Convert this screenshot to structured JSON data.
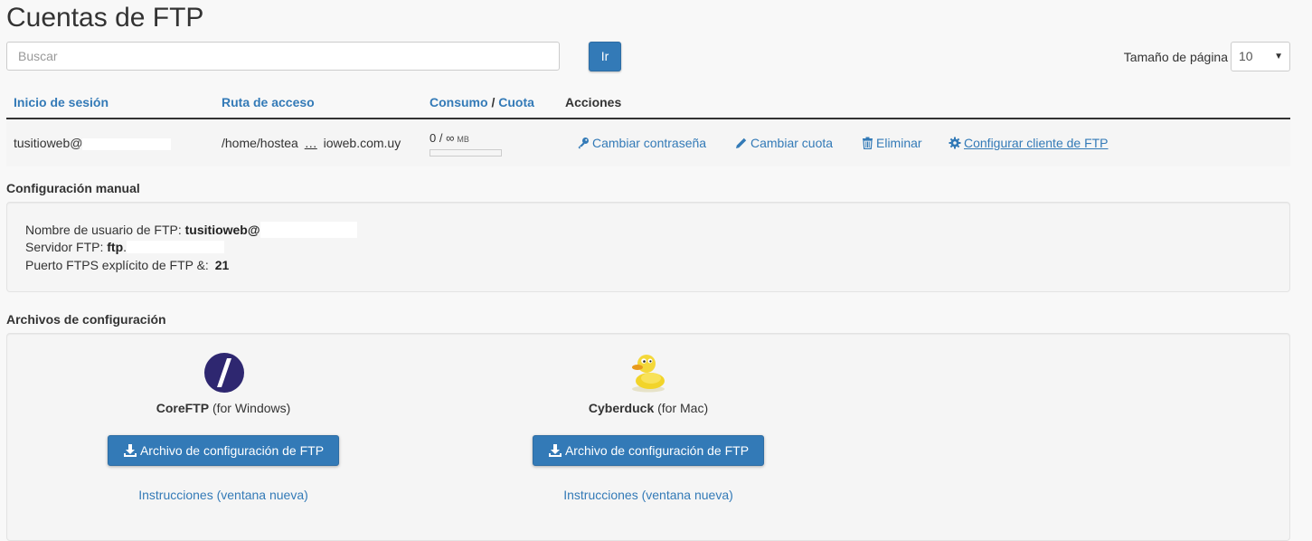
{
  "page": {
    "title": "Cuentas de FTP"
  },
  "search": {
    "placeholder": "Buscar",
    "value": "",
    "go_label": "Ir"
  },
  "pagination": {
    "page_size_label": "Tamaño de página",
    "page_size": "10"
  },
  "table": {
    "headers": {
      "login": "Inicio de sesión",
      "path": "Ruta de acceso",
      "usage": "Consumo",
      "usage_sep": "/",
      "quota": "Cuota",
      "actions": "Acciones"
    },
    "rows": [
      {
        "login": "tusitioweb@",
        "path_start": "/home/hostea",
        "path_ellipsis": "…",
        "path_end": "ioweb.com.uy",
        "usage_text": "0 / ∞",
        "usage_unit": "MB",
        "usage_fraction": 0
      }
    ],
    "actions": {
      "change_password": "Cambiar contraseña",
      "change_quota": "Cambiar cuota",
      "delete": "Eliminar",
      "configure_client": "Configurar cliente de FTP"
    }
  },
  "manual": {
    "title": "Configuración manual",
    "username_label": "Nombre de usuario de FTP:",
    "username_value": "tusitioweb@",
    "server_label": "Servidor FTP:",
    "server_value": "ftp",
    "server_suffix": ".",
    "port_label": "Puerto FTPS explícito de FTP &:",
    "port_value": "21"
  },
  "config_files": {
    "title": "Archivos de configuración",
    "clients": [
      {
        "name": "CoreFTP",
        "platform": "(for Windows)",
        "button": "Archivo de configuración de FTP",
        "instructions": "Instrucciones (ventana nueva)",
        "icon": "coreftp-logo-icon"
      },
      {
        "name": "Cyberduck",
        "platform": "(for Mac)",
        "button": "Archivo de configuración de FTP",
        "instructions": "Instrucciones (ventana nueva)",
        "icon": "cyberduck-logo-icon"
      }
    ]
  },
  "colors": {
    "link": "#337ab7",
    "button": "#337ab7",
    "text": "#333333",
    "background": "#f8f8f8"
  }
}
